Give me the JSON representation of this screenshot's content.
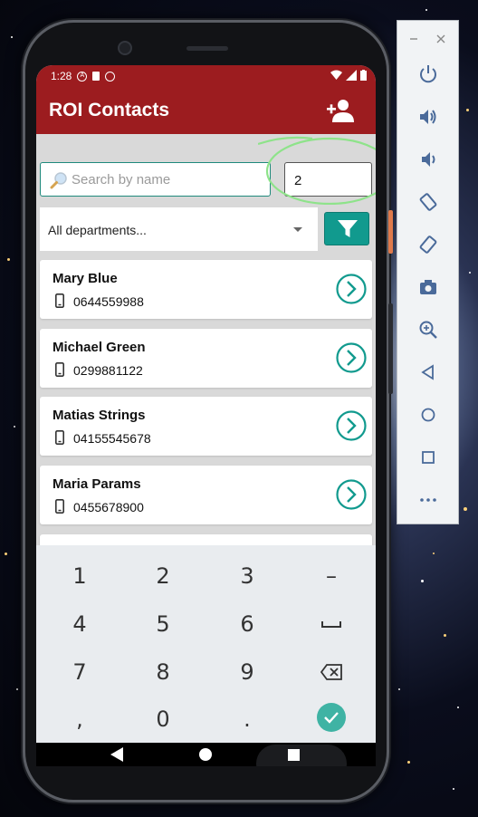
{
  "status_bar": {
    "time": "1:28"
  },
  "app": {
    "title": "ROI Contacts"
  },
  "search": {
    "placeholder": "Search by name"
  },
  "number_field": {
    "value": "2"
  },
  "department_filter": {
    "selected": "All departments..."
  },
  "contacts": [
    {
      "name": "Mary Blue",
      "phone": "0644559988"
    },
    {
      "name": "Michael Green",
      "phone": "0299881122"
    },
    {
      "name": "Matias Strings",
      "phone": "04155545678"
    },
    {
      "name": "Maria Params",
      "phone": "0455678900"
    }
  ],
  "keyboard": {
    "keys": [
      "1",
      "2",
      "3",
      "–",
      "4",
      "5",
      "6",
      "␣",
      "7",
      "8",
      "9",
      "backspace",
      ",",
      "0",
      ".",
      "done"
    ]
  },
  "colors": {
    "app_bar": "#9c1c1f",
    "accent": "#119a8e",
    "highlight_circle": "#8ee38a"
  },
  "emulator_toolbar": {
    "items": [
      "minimize-icon",
      "close-icon",
      "power-icon",
      "volume-up-icon",
      "volume-down-icon",
      "rotate-left-icon",
      "rotate-right-icon",
      "camera-icon",
      "zoom-icon",
      "back-icon",
      "home-icon",
      "overview-icon",
      "more-icon"
    ]
  }
}
